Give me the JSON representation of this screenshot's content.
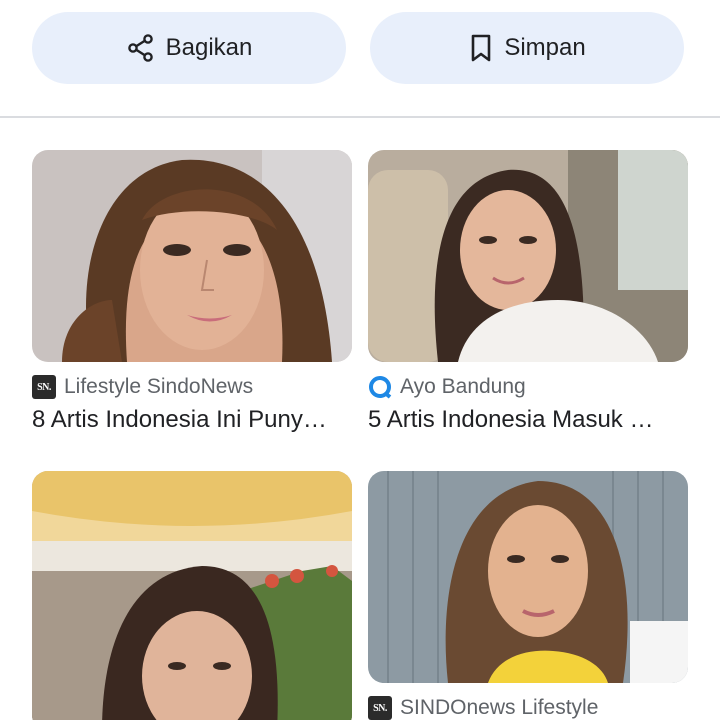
{
  "actions": {
    "share_label": "Bagikan",
    "save_label": "Simpan",
    "share_icon": "share-icon",
    "save_icon": "bookmark-icon"
  },
  "results": [
    {
      "source": "Lifestyle SindoNews",
      "source_icon": "sindonews-favicon",
      "title": "8 Artis Indonesia Ini Puny…"
    },
    {
      "source": "Ayo Bandung",
      "source_icon": "ayobandung-favicon",
      "title": "5 Artis Indonesia Masuk …"
    },
    {
      "source": "",
      "source_icon": "",
      "title": ""
    },
    {
      "source": "SINDOnews Lifestyle",
      "source_icon": "sindonews-favicon",
      "title": ""
    }
  ],
  "colors": {
    "pill_bg": "#e8effb",
    "divider": "#dadce0",
    "text_primary": "#202124",
    "text_secondary": "#5f6368"
  }
}
